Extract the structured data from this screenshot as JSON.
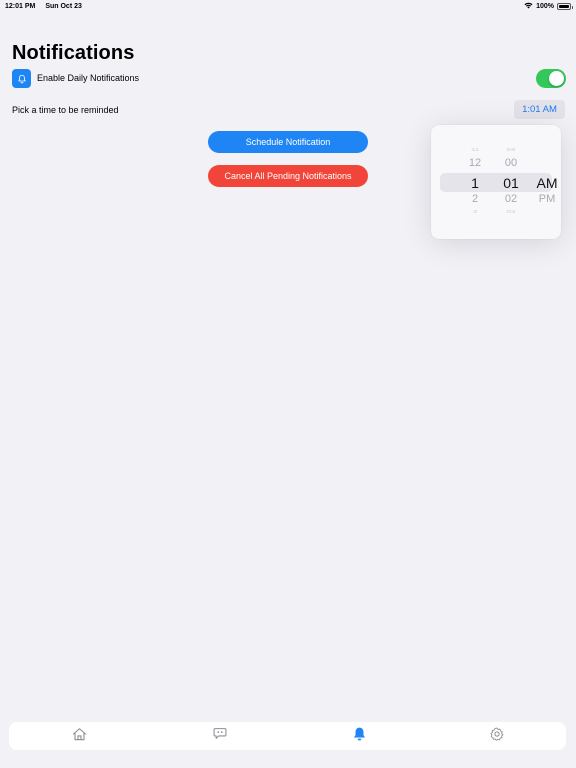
{
  "status_bar": {
    "time": "12:01 PM",
    "date": "Sun Oct 23",
    "battery": "100%",
    "icons": [
      "wifi-icon",
      "battery-icon"
    ]
  },
  "header": {
    "title": "Notifications"
  },
  "settings": {
    "enable_label": "Enable Daily Notifications",
    "enable_icon": "bell-icon",
    "enabled": true,
    "pick_time_label": "Pick a time to be reminded",
    "selected_time": "1:01 AM"
  },
  "actions": {
    "schedule_label": "Schedule Notification",
    "cancel_label": "Cancel All Pending Notifications"
  },
  "time_picker": {
    "hours": [
      "11",
      "12",
      "1",
      "2",
      "3"
    ],
    "minutes": [
      "59",
      "00",
      "01",
      "02",
      "03"
    ],
    "periods": [
      "AM",
      "PM"
    ]
  },
  "tab_bar": {
    "tabs": [
      {
        "icon": "home-icon",
        "selected": false
      },
      {
        "icon": "chat-icon",
        "selected": false
      },
      {
        "icon": "bell-icon",
        "selected": true
      },
      {
        "icon": "gear-icon",
        "selected": false
      }
    ]
  },
  "colors": {
    "accent": "#1f84f4",
    "destructive": "#f1453a",
    "toggle_on": "#34c759",
    "background": "#f2f1f6",
    "tab_inactive": "#8e8e93"
  }
}
